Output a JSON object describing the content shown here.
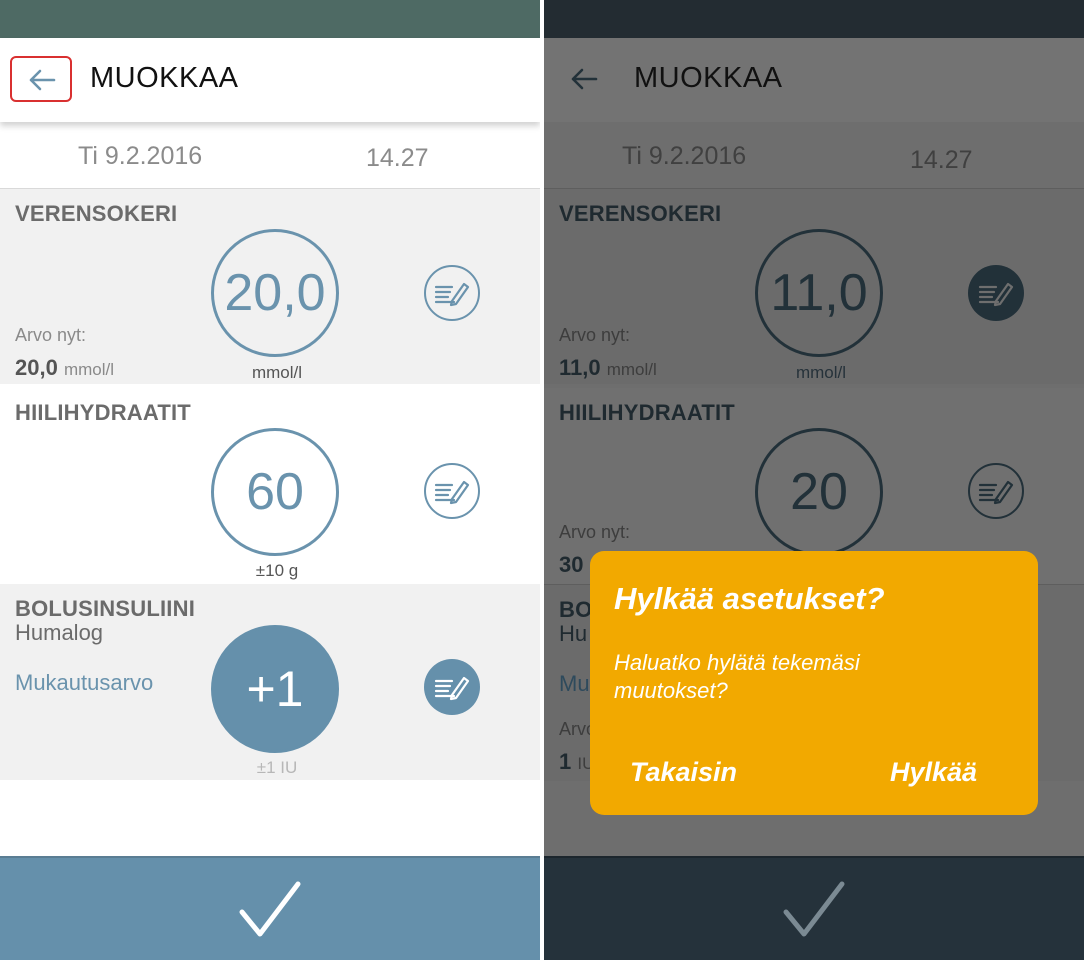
{
  "left": {
    "appbar": {
      "title": "MUOKKAA"
    },
    "date": "Ti 9.2.2016",
    "time": "14.27",
    "blood_sugar": {
      "title": "VERENSOKERI",
      "value": "20,0",
      "unit": "mmol/l",
      "current_label": "Arvo nyt:",
      "current_value": "20,0",
      "current_unit": "mmol/l"
    },
    "carbs": {
      "title": "HIILIHYDRAATIT",
      "value": "60",
      "unit": "±10 g"
    },
    "bolus": {
      "title": "BOLUSINSULIINI",
      "insulin_name": "Humalog",
      "adjust_label": "Mukautusarvo",
      "value": "+1",
      "unit": "±1 IU"
    }
  },
  "right": {
    "appbar": {
      "title": "MUOKKAA"
    },
    "date": "Ti 9.2.2016",
    "time": "14.27",
    "blood_sugar": {
      "title": "VERENSOKERI",
      "value": "11,0",
      "unit": "mmol/l",
      "current_label": "Arvo nyt:",
      "current_value": "11,0",
      "current_unit": "mmol/l"
    },
    "carbs": {
      "title": "HIILIHYDRAATIT",
      "value": "20",
      "current_label": "Arvo nyt:",
      "current_value": "30"
    },
    "bolus": {
      "title_partial": "BO",
      "name_partial": "Hu",
      "adjust_partial": "Mu",
      "current_label_partial": "Arvo",
      "current_value_partial": "1",
      "current_unit_partial": "IU"
    },
    "dialog": {
      "title": "Hylkää asetukset?",
      "message": "Haluatko hylätä tekemäsi muutokset?",
      "back_button": "Takaisin",
      "discard_button": "Hylkää"
    }
  },
  "colors": {
    "accent": "#6590ab",
    "dialog": "#f2a900",
    "highlight": "#d93030"
  }
}
